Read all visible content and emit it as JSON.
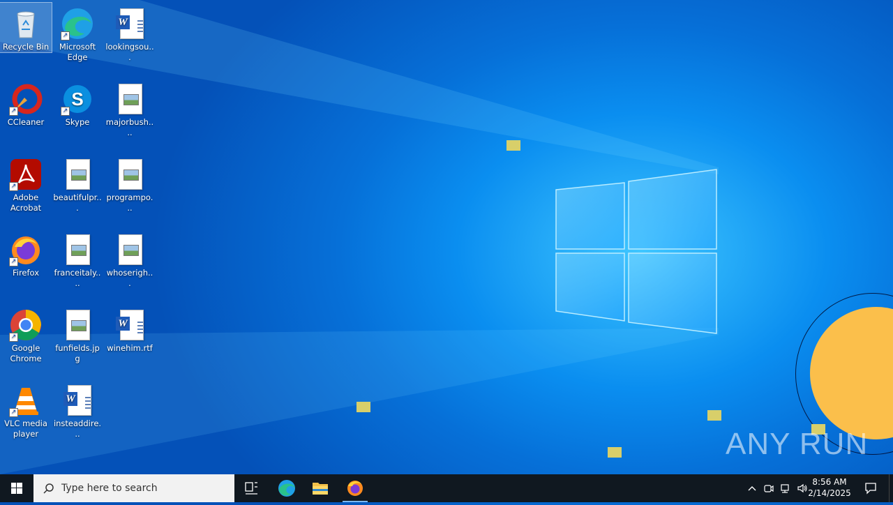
{
  "desktop": {
    "icons": [
      {
        "label": "Recycle Bin",
        "icon": "recycle-bin-icon"
      },
      {
        "label": "Microsoft Edge",
        "icon": "edge-icon"
      },
      {
        "label": "lookingsou...",
        "icon": "word-doc-icon"
      },
      {
        "label": "CCleaner",
        "icon": "ccleaner-icon"
      },
      {
        "label": "Skype",
        "icon": "skype-icon"
      },
      {
        "label": "majorbush....",
        "icon": "image-file-icon"
      },
      {
        "label": "Adobe Acrobat",
        "icon": "acrobat-icon"
      },
      {
        "label": "beautifulpr...",
        "icon": "image-file-icon"
      },
      {
        "label": "programpo...",
        "icon": "image-file-icon"
      },
      {
        "label": "Firefox",
        "icon": "firefox-icon"
      },
      {
        "label": "franceitaly....",
        "icon": "image-file-icon"
      },
      {
        "label": "whoserigh...",
        "icon": "image-file-icon"
      },
      {
        "label": "Google Chrome",
        "icon": "chrome-icon"
      },
      {
        "label": "funfields.jpg",
        "icon": "image-file-icon"
      },
      {
        "label": "winehim.rtf",
        "icon": "word-doc-icon"
      },
      {
        "label": "VLC media player",
        "icon": "vlc-icon"
      },
      {
        "label": "insteaddire...",
        "icon": "word-doc-icon"
      }
    ]
  },
  "taskbar": {
    "search_placeholder": "Type here to search",
    "time": "8:56 AM",
    "date": "2/14/2025",
    "pinned": [
      "task-view-icon",
      "edge-icon",
      "file-explorer-icon",
      "firefox-icon"
    ]
  },
  "watermark": "ANY RUN",
  "colors": {
    "taskbar": "#101820",
    "accent_blue": "#0a8ef0",
    "recorder": "#fbbf4b"
  }
}
